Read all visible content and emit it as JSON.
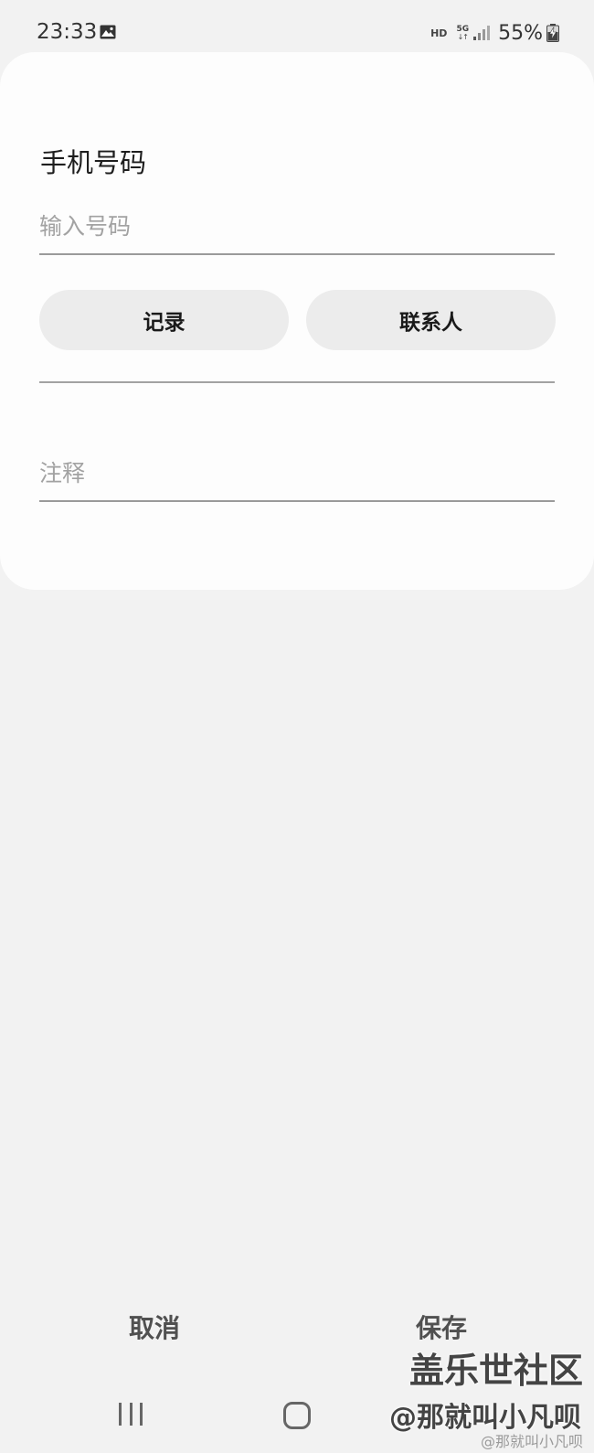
{
  "status_bar": {
    "time": "23:33",
    "gallery_icon": "image-icon",
    "network_label": "HD",
    "network_type": "5G",
    "network_arrows": "↓↑",
    "battery_percent": "55%",
    "battery_icon": "battery-charging-icon"
  },
  "form": {
    "section_title": "手机号码",
    "phone_placeholder": "输入号码",
    "phone_value": "",
    "logs_button": "记录",
    "contacts_button": "联系人",
    "note_placeholder": "注释",
    "note_value": ""
  },
  "actions": {
    "cancel": "取消",
    "save": "保存"
  },
  "nav_bar": {
    "recents_icon": "recents-icon",
    "home_icon": "home-icon"
  },
  "watermark": {
    "line1": "盖乐世社区",
    "line2": "@那就叫小凡呗",
    "line3": "@那就叫小凡呗"
  },
  "colors": {
    "background": "#f2f2f2",
    "card": "#fdfdfd",
    "pill": "#ececec",
    "placeholder": "#a2a2a2",
    "divider": "#a2a2a2"
  }
}
